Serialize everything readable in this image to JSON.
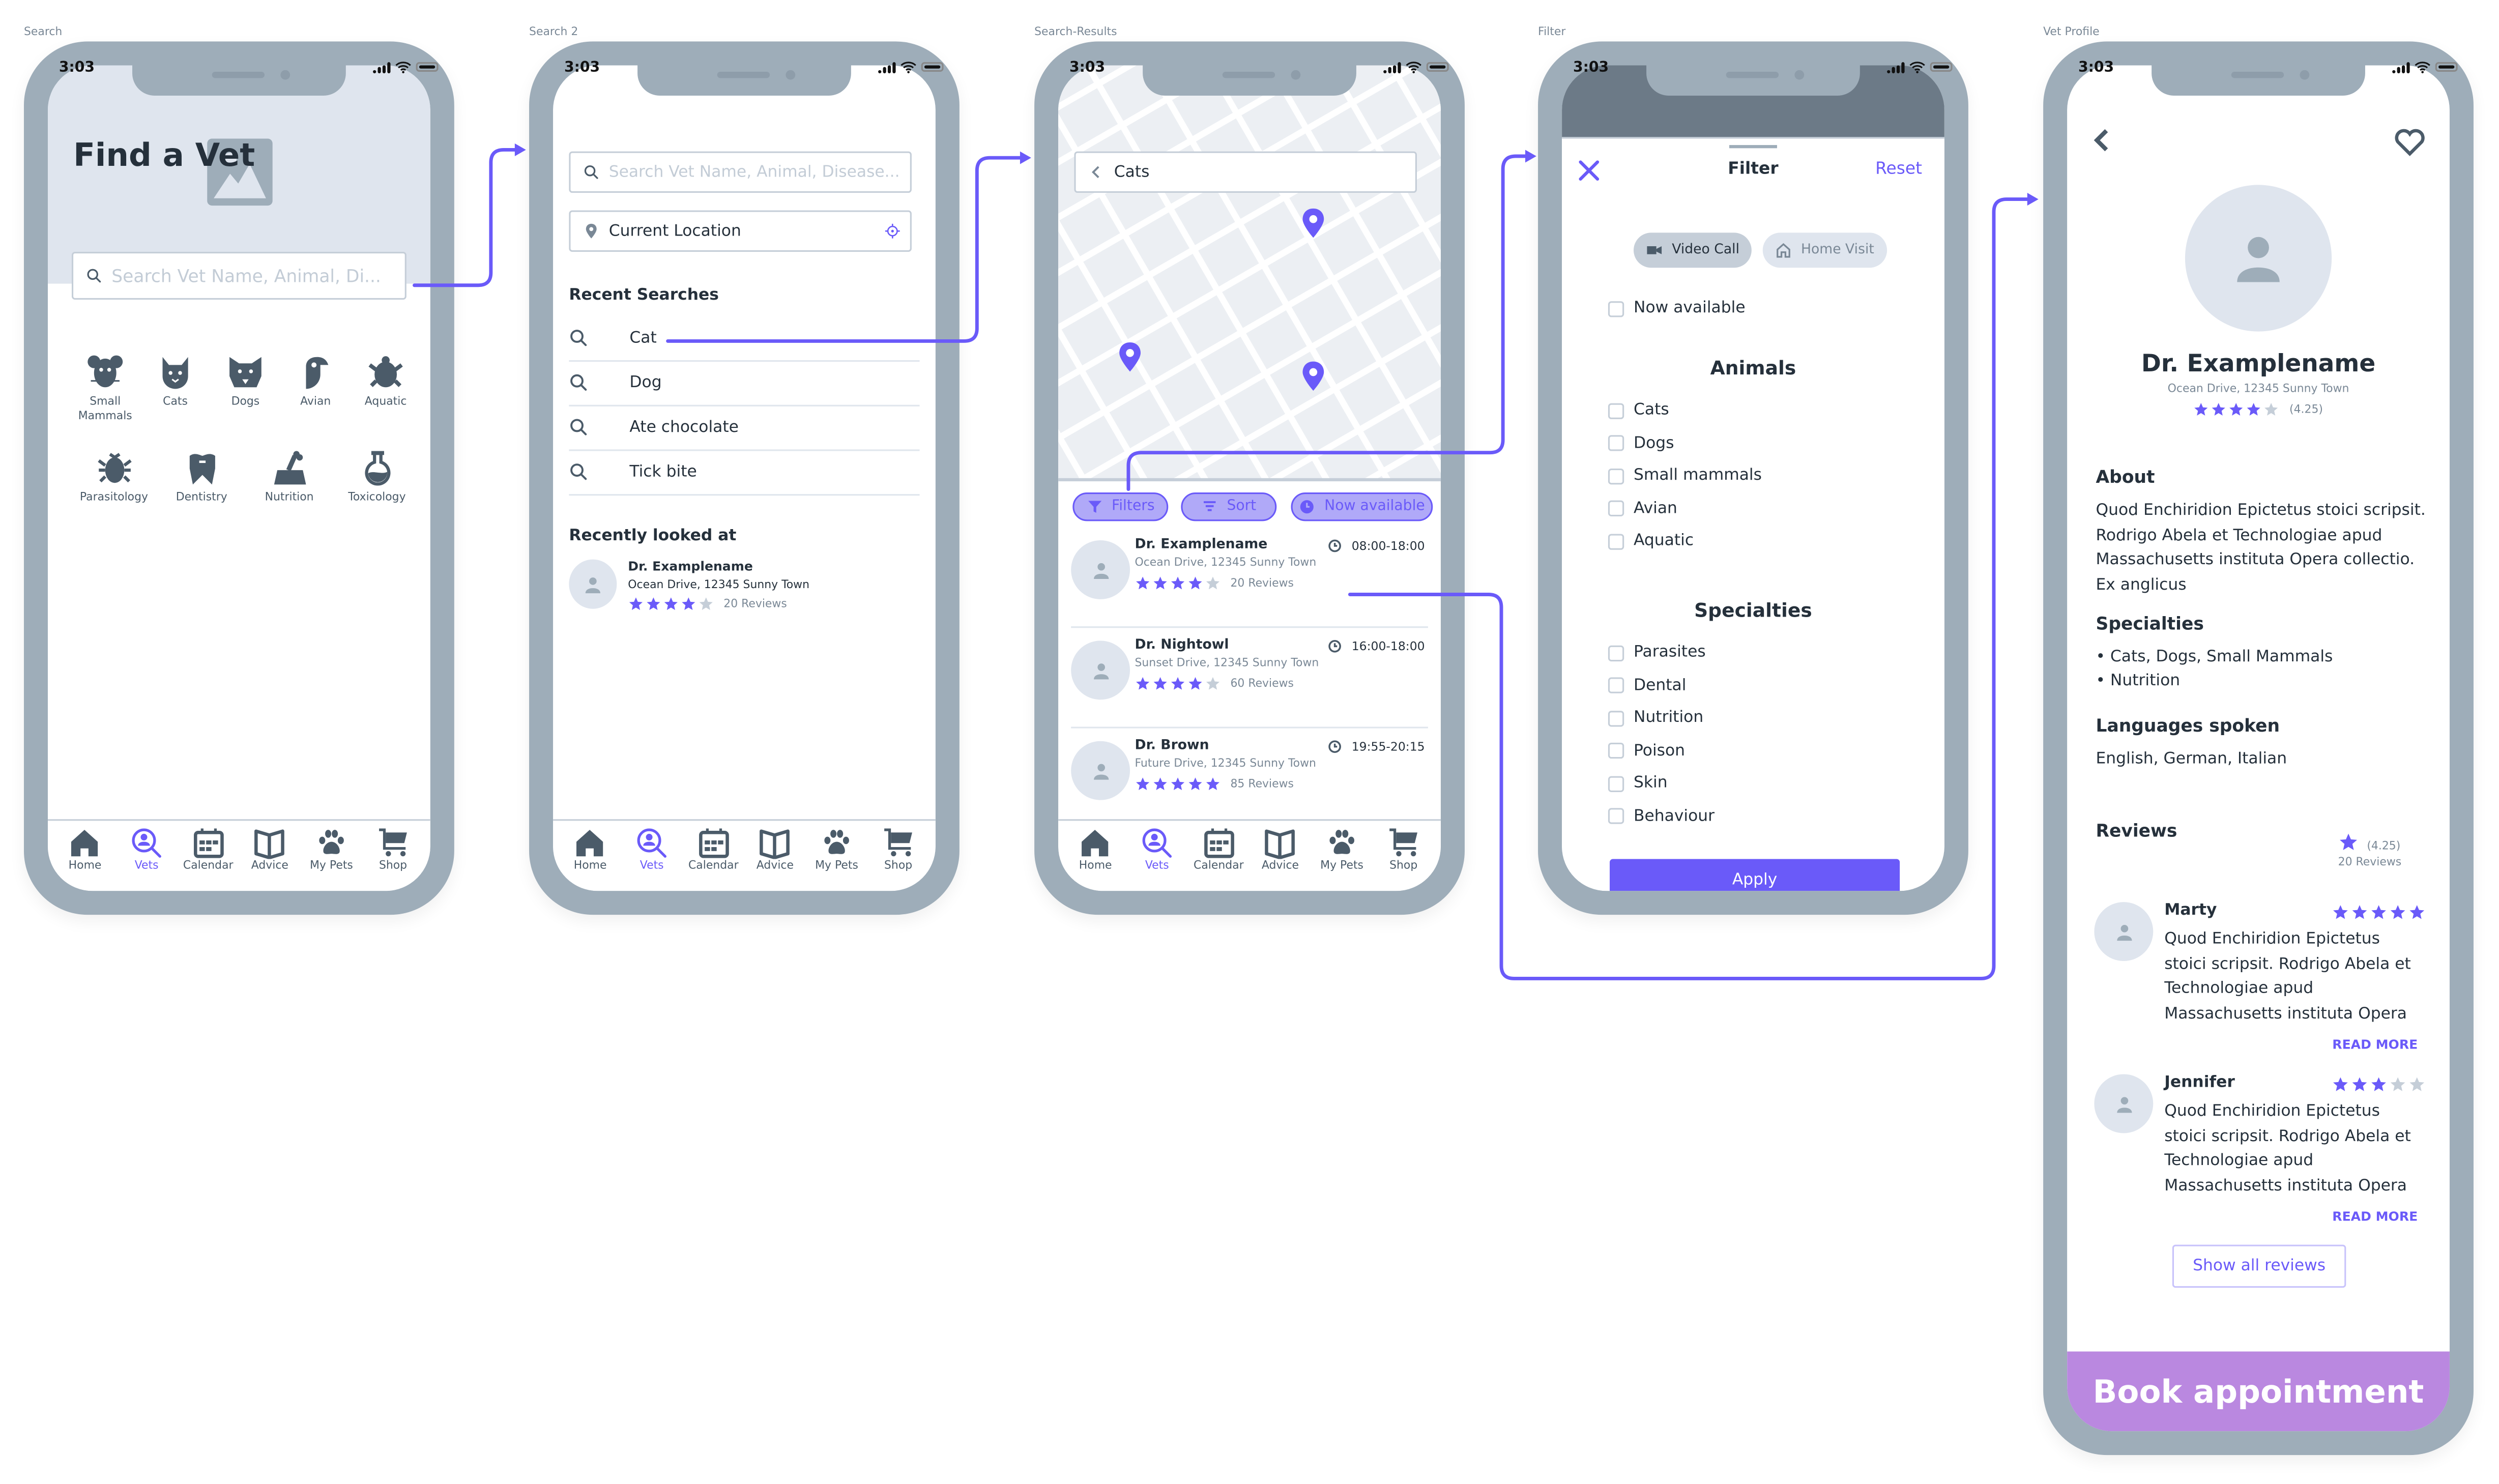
{
  "colors": {
    "accent": "#6a5af9",
    "accent_light": "#b0a9f8",
    "book_button": "#ba88e0",
    "phone_frame": "#9eadb9",
    "text_dark": "#25303b",
    "text_muted": "#7a8896",
    "star_empty": "#c5ced8"
  },
  "status_bar": {
    "time": "3:03"
  },
  "bottom_nav": [
    {
      "label": "Home",
      "icon": "home-icon"
    },
    {
      "label": "Vets",
      "icon": "vet-search-icon",
      "active": true
    },
    {
      "label": "Calendar",
      "icon": "calendar-icon"
    },
    {
      "label": "Advice",
      "icon": "book-icon"
    },
    {
      "label": "My Pets",
      "icon": "paw-icon"
    },
    {
      "label": "Shop",
      "icon": "cart-icon"
    }
  ],
  "screens": {
    "search": {
      "frame_label": "Search",
      "title": "Find a Vet",
      "search_placeholder": "Search Vet Name, Animal, Di...",
      "categories": [
        {
          "label": "Small Mammals",
          "icon": "mouse-icon"
        },
        {
          "label": "Cats",
          "icon": "cat-icon"
        },
        {
          "label": "Dogs",
          "icon": "dog-icon"
        },
        {
          "label": "Avian",
          "icon": "bird-icon"
        },
        {
          "label": "Aquatic",
          "icon": "turtle-icon"
        },
        {
          "label": "Parasitology",
          "icon": "bug-icon"
        },
        {
          "label": "Dentistry",
          "icon": "tooth-icon"
        },
        {
          "label": "Nutrition",
          "icon": "food-bowl-icon"
        },
        {
          "label": "Toxicology",
          "icon": "flask-icon"
        }
      ]
    },
    "search2": {
      "frame_label": "Search 2",
      "search_placeholder": "Search Vet Name, Animal, Disease...",
      "location_value": "Current Location",
      "recent_title": "Recent Searches",
      "recent": [
        "Cat",
        "Dog",
        "Ate chocolate",
        "Tick bite"
      ],
      "recently_viewed_title": "Recently looked at",
      "recently_viewed": {
        "name": "Dr. Examplename",
        "address": "Ocean Drive, 12345 Sunny Town",
        "rating": 4,
        "reviews": "20 Reviews"
      }
    },
    "results": {
      "frame_label": "Search-Results",
      "query": "Cats",
      "chips": [
        "Filters",
        "Sort",
        "Now available"
      ],
      "vets": [
        {
          "name": "Dr. Examplename",
          "address": "Ocean Drive, 12345 Sunny Town",
          "hours": "08:00-18:00",
          "rating": 4,
          "reviews": "20 Reviews"
        },
        {
          "name": "Dr. Nightowl",
          "address": "Sunset Drive, 12345 Sunny Town",
          "hours": "16:00-18:00",
          "rating": 4,
          "reviews": "60 Reviews"
        },
        {
          "name": "Dr. Brown",
          "address": "Future Drive, 12345 Sunny Town",
          "hours": "19:55-20:15",
          "rating": 5,
          "reviews": "85 Reviews"
        }
      ]
    },
    "filter": {
      "frame_label": "Filter",
      "title": "Filter",
      "reset": "Reset",
      "modes": [
        {
          "label": "Video Call",
          "selected": true
        },
        {
          "label": "Home Visit",
          "selected": false
        }
      ],
      "now_available": "Now available",
      "animals_title": "Animals",
      "animals": [
        "Cats",
        "Dogs",
        "Small mammals",
        "Avian",
        "Aquatic"
      ],
      "specialties_title": "Specialties",
      "specialties": [
        "Parasites",
        "Dental",
        "Nutrition",
        "Poison",
        "Skin",
        "Behaviour"
      ],
      "apply": "Apply"
    },
    "profile": {
      "frame_label": "Vet Profile",
      "name": "Dr. Examplename",
      "address": "Ocean Drive, 12345 Sunny Town",
      "rating": 4,
      "rating_text": "(4.25)",
      "about_title": "About",
      "about_text": "Quod Enchiridion Epictetus stoici scripsit. Rodrigo Abela et Technologiae apud Massachusetts instituta Opera collectio. Ex anglicus",
      "specialties_title": "Specialties",
      "specialties": [
        "• Cats, Dogs, Small Mammals",
        "• Nutrition"
      ],
      "languages_title": "Languages spoken",
      "languages": "English, German, Italian",
      "reviews_title": "Reviews",
      "reviews_rating": "(4.25)",
      "reviews_count": "20 Reviews",
      "reviews": [
        {
          "author": "Marty",
          "rating": 5,
          "text": "Quod Enchiridion Epictetus stoici scripsit. Rodrigo Abela et Technologiae apud Massachusetts instituta Opera",
          "read_more": "READ MORE"
        },
        {
          "author": "Jennifer",
          "rating": 3,
          "text": "Quod Enchiridion Epictetus stoici scripsit. Rodrigo Abela et Technologiae apud Massachusetts instituta Opera",
          "read_more": "READ MORE"
        }
      ],
      "show_all": "Show all reviews",
      "book": "Book appointment"
    }
  }
}
